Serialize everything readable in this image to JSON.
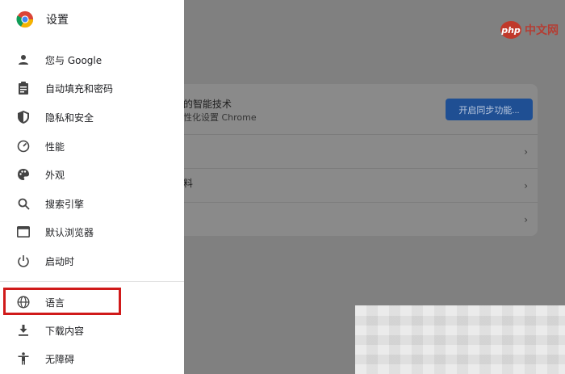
{
  "sidebar": {
    "title": "设置",
    "items": [
      {
        "label": "您与 Google",
        "icon": "person-icon"
      },
      {
        "label": "自动填充和密码",
        "icon": "clipboard-icon"
      },
      {
        "label": "隐私和安全",
        "icon": "shield-icon"
      },
      {
        "label": "性能",
        "icon": "speedometer-icon"
      },
      {
        "label": "外观",
        "icon": "palette-icon"
      },
      {
        "label": "搜索引擎",
        "icon": "search-icon"
      },
      {
        "label": "默认浏览器",
        "icon": "browser-window-icon"
      },
      {
        "label": "启动时",
        "icon": "power-icon"
      },
      {
        "label": "语言",
        "icon": "globe-icon"
      },
      {
        "label": "下载内容",
        "icon": "download-icon"
      },
      {
        "label": "无障碍",
        "icon": "accessibility-icon"
      }
    ]
  },
  "main": {
    "sync_title": "的智能技术",
    "sync_subtitle": "性化设置 Chrome",
    "sync_button": "开启同步功能...",
    "row2_label": "料"
  },
  "watermark": {
    "php": "php",
    "cn": "中文网"
  },
  "colors": {
    "highlight": "#d01a1a",
    "button": "#1f4f93"
  }
}
